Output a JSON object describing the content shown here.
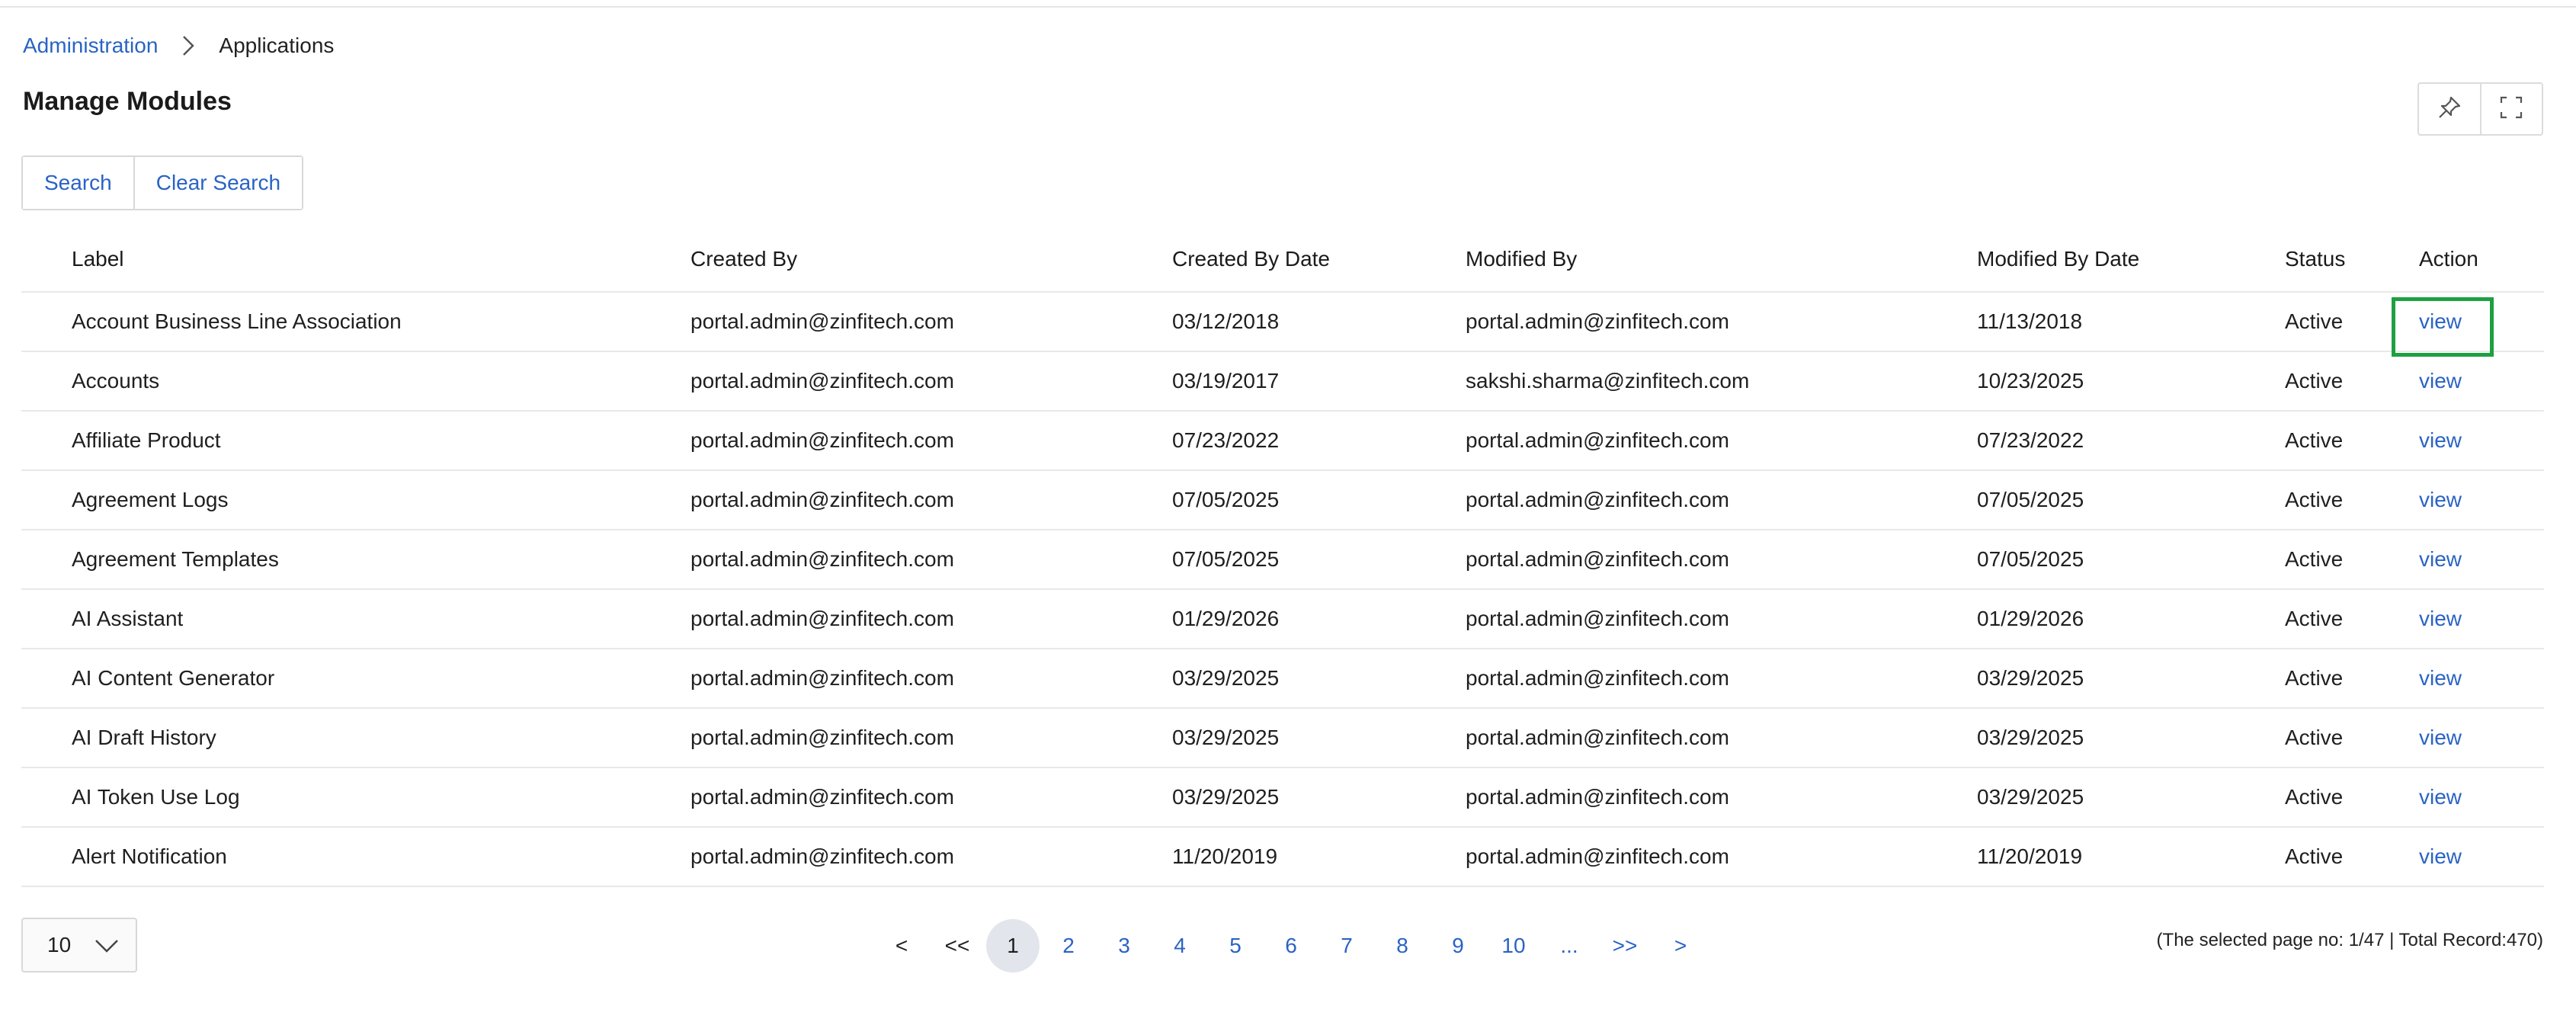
{
  "breadcrumb": {
    "parent": "Administration",
    "current": "Applications"
  },
  "page": {
    "title": "Manage Modules"
  },
  "toolbar": {
    "search_label": "Search",
    "clear_search_label": "Clear Search"
  },
  "icons": {
    "breadcrumb_separator": "chevron-right-icon",
    "pin": "pin-icon",
    "fullscreen": "fullscreen-icon",
    "page_size_dropdown": "chevron-down-icon"
  },
  "colors": {
    "link": "#2a63c4",
    "focus_outline": "#1ea042"
  },
  "table": {
    "columns": [
      "Label",
      "Created By",
      "Created By Date",
      "Modified By",
      "Modified By Date",
      "Status",
      "Action"
    ],
    "rows": [
      {
        "label": "Account Business Line Association",
        "created_by": "portal.admin@zinfitech.com",
        "created_date": "03/12/2018",
        "modified_by": "portal.admin@zinfitech.com",
        "modified_date": "11/13/2018",
        "status": "Active",
        "action": "view"
      },
      {
        "label": "Accounts",
        "created_by": "portal.admin@zinfitech.com",
        "created_date": "03/19/2017",
        "modified_by": "sakshi.sharma@zinfitech.com",
        "modified_date": "10/23/2025",
        "status": "Active",
        "action": "view"
      },
      {
        "label": "Affiliate Product",
        "created_by": "portal.admin@zinfitech.com",
        "created_date": "07/23/2022",
        "modified_by": "portal.admin@zinfitech.com",
        "modified_date": "07/23/2022",
        "status": "Active",
        "action": "view"
      },
      {
        "label": "Agreement Logs",
        "created_by": "portal.admin@zinfitech.com",
        "created_date": "07/05/2025",
        "modified_by": "portal.admin@zinfitech.com",
        "modified_date": "07/05/2025",
        "status": "Active",
        "action": "view"
      },
      {
        "label": "Agreement Templates",
        "created_by": "portal.admin@zinfitech.com",
        "created_date": "07/05/2025",
        "modified_by": "portal.admin@zinfitech.com",
        "modified_date": "07/05/2025",
        "status": "Active",
        "action": "view"
      },
      {
        "label": "AI Assistant",
        "created_by": "portal.admin@zinfitech.com",
        "created_date": "01/29/2026",
        "modified_by": "portal.admin@zinfitech.com",
        "modified_date": "01/29/2026",
        "status": "Active",
        "action": "view"
      },
      {
        "label": "AI Content Generator",
        "created_by": "portal.admin@zinfitech.com",
        "created_date": "03/29/2025",
        "modified_by": "portal.admin@zinfitech.com",
        "modified_date": "03/29/2025",
        "status": "Active",
        "action": "view"
      },
      {
        "label": "AI Draft History",
        "created_by": "portal.admin@zinfitech.com",
        "created_date": "03/29/2025",
        "modified_by": "portal.admin@zinfitech.com",
        "modified_date": "03/29/2025",
        "status": "Active",
        "action": "view"
      },
      {
        "label": "AI Token Use Log",
        "created_by": "portal.admin@zinfitech.com",
        "created_date": "03/29/2025",
        "modified_by": "portal.admin@zinfitech.com",
        "modified_date": "03/29/2025",
        "status": "Active",
        "action": "view"
      },
      {
        "label": "Alert Notification",
        "created_by": "portal.admin@zinfitech.com",
        "created_date": "11/20/2019",
        "modified_by": "portal.admin@zinfitech.com",
        "modified_date": "11/20/2019",
        "status": "Active",
        "action": "view"
      }
    ]
  },
  "pagination": {
    "page_size": "10",
    "prev": "<",
    "first": "<<",
    "pages": [
      "1",
      "2",
      "3",
      "4",
      "5",
      "6",
      "7",
      "8",
      "9",
      "10"
    ],
    "active_page": "1",
    "ellipsis": "...",
    "last": ">>",
    "next": ">",
    "info": "(The selected page no: 1/47 | Total Record:470)"
  }
}
